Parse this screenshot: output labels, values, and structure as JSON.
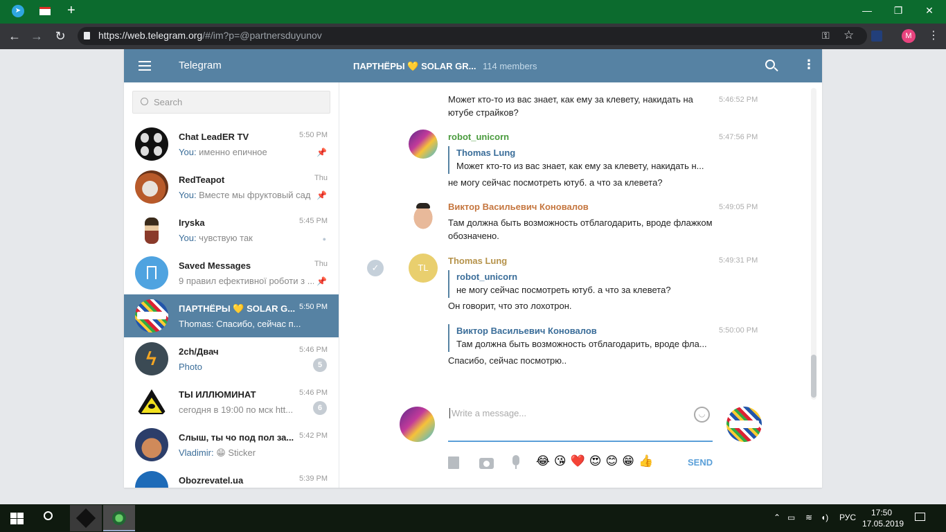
{
  "browser": {
    "url_host": "https://web.telegram.org",
    "url_path": "/#/im?p=@partnersduyunov",
    "profile_initial": "M"
  },
  "header": {
    "app_title": "Telegram",
    "chat_title": "ПАРТНЁРЫ 💛 SOLAR GR...",
    "chat_members": "114 members"
  },
  "search": {
    "placeholder": "Search"
  },
  "dialogs": [
    {
      "name": "Chat LeadER TV",
      "time": "5:50 PM",
      "from": "You:",
      "text": " именно епичное",
      "pinned": "📌"
    },
    {
      "name": "RedTeapot",
      "time": "Thu",
      "from": "You:",
      "text": " Вместе мы фруктовый сад",
      "pinned": "📌"
    },
    {
      "name": "Iryska",
      "time": "5:45 PM",
      "from": "You:",
      "text": " чувствую так",
      "pinned": "●"
    },
    {
      "name": "Saved Messages",
      "time": "Thu",
      "from": "",
      "text": "9 правил ефективної роботи з ...",
      "pinned": "📌"
    },
    {
      "name": "ПАРТНЁРЫ 💛 SOLAR G...",
      "time": "5:50 PM",
      "from": "",
      "text": "Thomas: Спасибо, сейчас п..."
    },
    {
      "name": "2ch/Двач",
      "time": "5:46 PM",
      "from": "Photo",
      "text": "",
      "badge": "5"
    },
    {
      "name": "ТЫ ИЛЛЮМИНАТ",
      "time": "5:46 PM",
      "from": "",
      "text": "сегодня в 19:00 по мск htt...",
      "badge": "6"
    },
    {
      "name": "Слыш, ты чо под пол за...",
      "time": "5:42 PM",
      "from": "Vladimir:",
      "text": " 😁 Sticker"
    },
    {
      "name": "Obozrevatel.ua",
      "time": "5:39 PM",
      "from": "",
      "text": ""
    }
  ],
  "messages": {
    "m0": {
      "text": "Может кто-то из вас знает, как ему за клевету, накидать на ютубе страйков?",
      "time": "5:46:52 PM"
    },
    "m1": {
      "author": "robot_unicorn",
      "time": "5:47:56 PM",
      "reply_author": "Thomas Lung",
      "reply_text": "Может кто-то из вас знает, как ему за клевету, накидать н...",
      "text": "не могу сейчас посмотреть ютуб. а что за клевета?"
    },
    "m2": {
      "author": "Виктор Васильевич Коновалов",
      "time": "5:49:05 PM",
      "text": "Там должна быть возможность отблагодарить, вроде флажком обозначено."
    },
    "m3": {
      "author": "Thomas Lung",
      "initials": "TL",
      "time": "5:49:31 PM",
      "reply_author": "robot_unicorn",
      "reply_text": "не могу сейчас посмотреть ютуб. а что за клевета?",
      "text": "Он говорит, что это лохотрон."
    },
    "m4": {
      "time": "5:50:00 PM",
      "reply_author": "Виктор Васильевич Коновалов",
      "reply_text": "Там должна быть возможность отблагодарить, вроде фла...",
      "text": "Спасибо, сейчас посмотрю.."
    }
  },
  "composer": {
    "placeholder": "Write a message...",
    "send_label": "SEND",
    "emojis": [
      "😂",
      "😘",
      "❤️",
      "😍",
      "😊",
      "😁",
      "👍"
    ]
  },
  "colors": {
    "header": "#5682a3",
    "active": "#5682a3",
    "author_green": "#4a9b3e",
    "author_orange": "#c5763f",
    "author_gold": "#b5924a"
  },
  "taskbar": {
    "lang": "РУС",
    "time": "17:50",
    "date": "17.05.2019"
  }
}
